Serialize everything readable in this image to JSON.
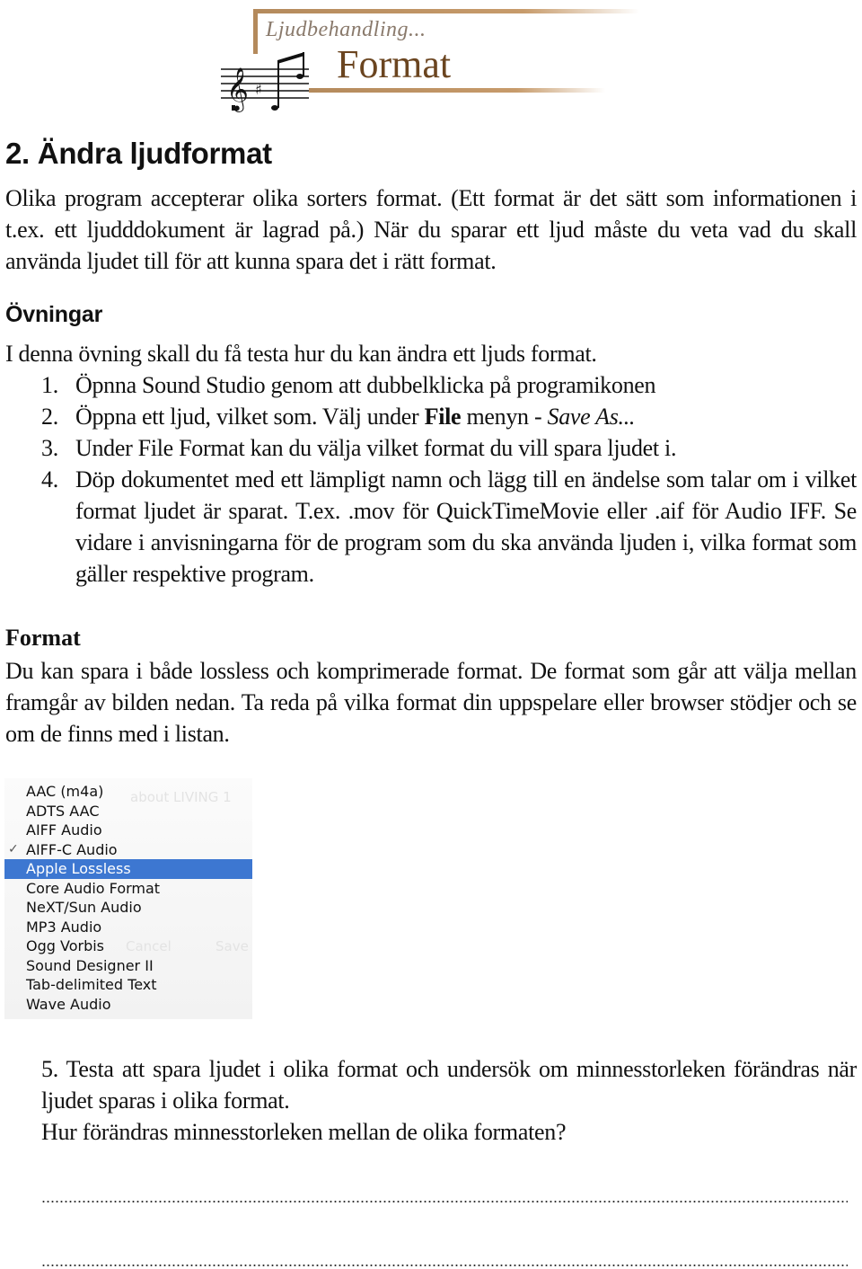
{
  "banner": {
    "subtitle": "Ljudbehandling...",
    "title": "Format",
    "icon": "music-notes-icon",
    "accent_color": "#b48a5c",
    "title_color": "#6b4520"
  },
  "heading": "2. Ändra ljudformat",
  "intro": "Olika program accepterar olika sorters format. (Ett format är det sätt som informationen i t.ex. ett ljudddokument är lagrad på.) När du sparar ett ljud måste du veta vad du skall använda ljudet till för att kunna spara det i rätt format.",
  "exercises": {
    "heading": "Övningar",
    "intro": "I denna övning skall du få testa hur du kan ändra ett ljuds format.",
    "steps": [
      {
        "num": "1.",
        "text": "Öpnna Sound Studio genom att dubbelklicka på programikonen"
      },
      {
        "num": "2.",
        "text_before": "Öppna ett ljud, vilket som. Välj under ",
        "bold": "File",
        "text_middle": " menyn - ",
        "italic": "Save As..."
      },
      {
        "num": "3.",
        "text": "Under File Format kan du välja vilket format du vill spara ljudet i."
      },
      {
        "num": "4.",
        "text": "Döp dokumentet med ett lämpligt namn och lägg till en ändelse som talar om i vilket format ljudet är sparat. T.ex. .mov för QuickTimeMovie eller .aif för Audio IFF. Se vidare i anvisningarna för de program som du ska använda ljuden i, vilka format som gäller respektive program."
      }
    ]
  },
  "format_section": {
    "heading": "Format",
    "text": "Du kan spara i både lossless och komprimerade format. De format som går att välja mellan framgår av bilden nedan. Ta reda på vilka format din uppspelare eller browser stödjer och se om de finns med i listan."
  },
  "format_menu": {
    "items": [
      {
        "label": "AAC (m4a)",
        "checked": false,
        "selected": false
      },
      {
        "label": "ADTS AAC",
        "checked": false,
        "selected": false
      },
      {
        "label": "AIFF Audio",
        "checked": false,
        "selected": false
      },
      {
        "label": "AIFF-C Audio",
        "checked": true,
        "selected": false
      },
      {
        "label": "Apple Lossless",
        "checked": false,
        "selected": true
      },
      {
        "label": "Core Audio Format",
        "checked": false,
        "selected": false
      },
      {
        "label": "NeXT/Sun Audio",
        "checked": false,
        "selected": false
      },
      {
        "label": "MP3 Audio",
        "checked": false,
        "selected": false
      },
      {
        "label": "Ogg Vorbis",
        "checked": false,
        "selected": false
      },
      {
        "label": "Sound Designer II",
        "checked": false,
        "selected": false
      },
      {
        "label": "Tab-delimited Text",
        "checked": false,
        "selected": false
      },
      {
        "label": "Wave Audio",
        "checked": false,
        "selected": false
      }
    ],
    "check_glyph": "✓",
    "highlight_color": "#3d77d1",
    "ghost_text": {
      "behind": "about LIVING 1",
      "cancel": "Cancel",
      "save": "Save"
    }
  },
  "task5": {
    "line1": "5. Testa att spara ljudet i olika format och undersök om minnesstorleken förändras när ljudet sparas i olika format.",
    "line2": "Hur förändras minnesstorleken mellan de olika formaten?"
  }
}
